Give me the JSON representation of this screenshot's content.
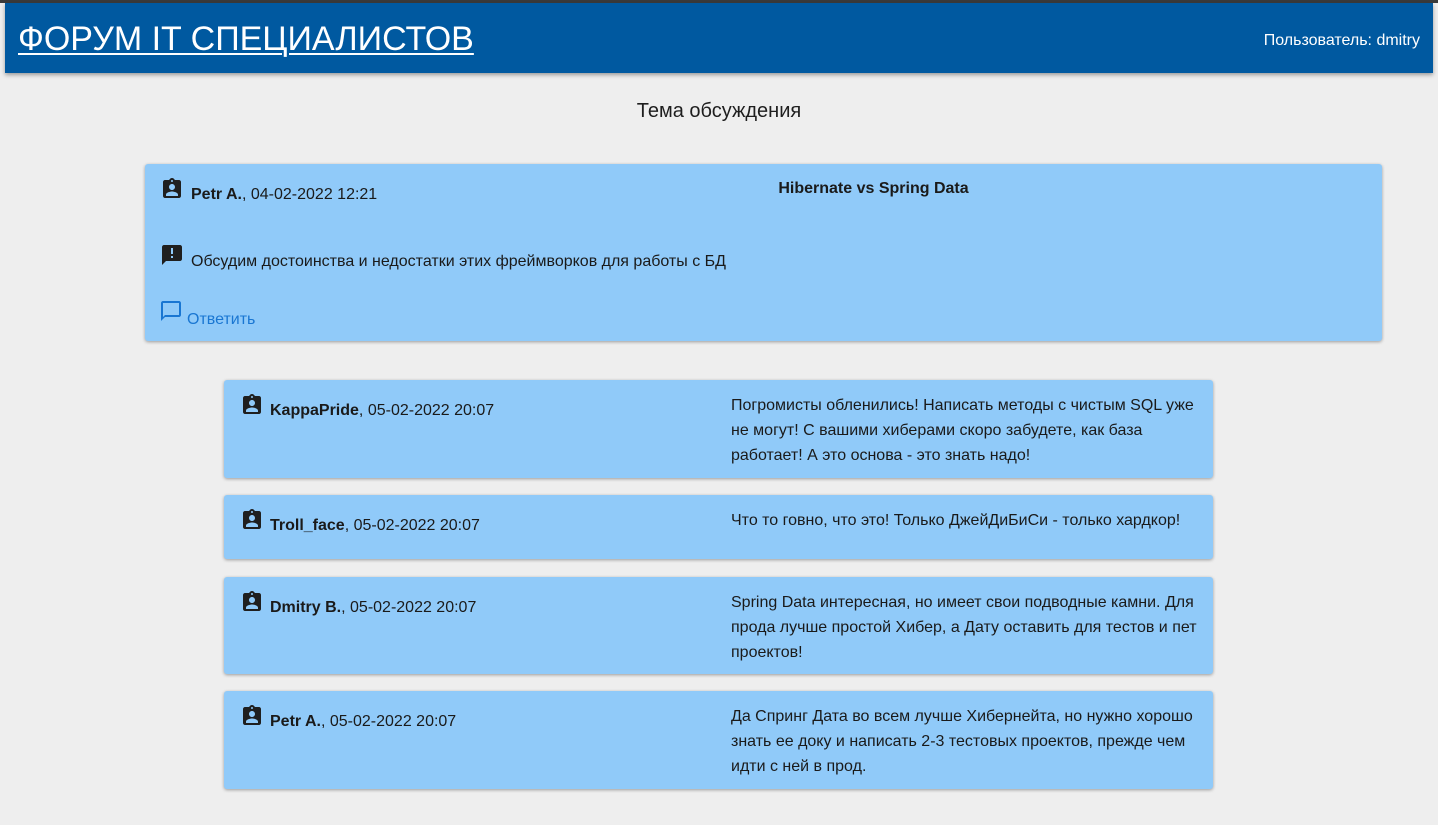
{
  "header": {
    "site_title": "ФОРУМ IT СПЕЦИАЛИСТОВ",
    "user_label": "Пользователь: dmitry",
    "background_color": "#0059a0"
  },
  "page": {
    "title": "Тема обсуждения",
    "card_color": "#90caf9",
    "background_color": "#eeeeee"
  },
  "topic": {
    "author": "Petr A.",
    "date": ", 04-02-2022 12:21",
    "subject": "Hibernate vs Spring Data",
    "body": "Обсудим достоинства и недостатки этих фреймворков для работы с БД",
    "reply_label": " Ответить",
    "author_icon": "assignment-ind-icon",
    "body_icon": "announcement-icon",
    "reply_icon": "chat-bubble-outline-icon"
  },
  "comments": [
    {
      "author": "KappaPride",
      "date": ", 05-02-2022 20:07",
      "text": "Погромисты обленились! Написать методы с чистым SQL уже не могут! С вашими хиберами скоро забудете, как база работает! А это основа - это знать надо!"
    },
    {
      "author": "Troll_face",
      "date": ", 05-02-2022 20:07",
      "text": "Что то говно, что это! Только ДжейДиБиСи - только хардкор!"
    },
    {
      "author": "Dmitry B.",
      "date": ", 05-02-2022 20:07",
      "text": "Spring Data интересная, но имеет свои подводные камни. Для прода лучше простой Хибер, а Дату оставить для тестов и пет проектов!"
    },
    {
      "author": "Petr A.",
      "date": ", 05-02-2022 20:07",
      "text": "Да Спринг Дата во всем лучше Хибернейта, но нужно хорошо знать ее доку и написать 2-3 тестовых проектов, прежде чем идти с ней в прод."
    }
  ]
}
